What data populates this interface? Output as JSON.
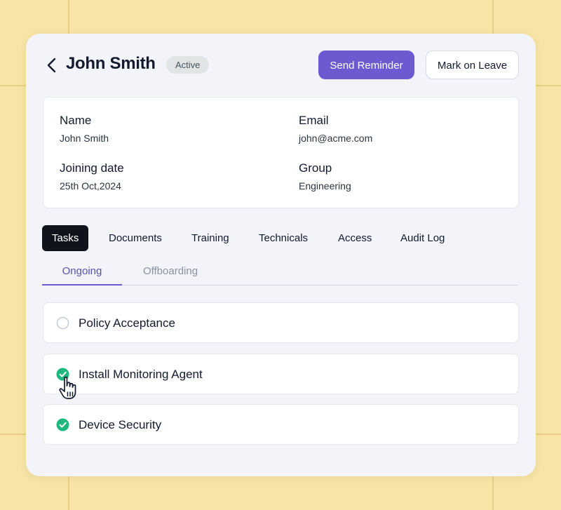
{
  "header": {
    "title": "John Smith",
    "status_badge": "Active",
    "send_reminder_label": "Send Reminder",
    "mark_on_leave_label": "Mark on Leave",
    "back_icon": "chevron-left-icon"
  },
  "profile": {
    "name": {
      "label": "Name",
      "value": "John Smith"
    },
    "email": {
      "label": "Email",
      "value": "john@acme.com"
    },
    "joining_date": {
      "label": "Joining date",
      "value": "25th Oct,2024"
    },
    "group": {
      "label": "Group",
      "value": "Engineering"
    }
  },
  "tabs": [
    {
      "label": "Tasks",
      "active": true
    },
    {
      "label": "Documents",
      "active": false
    },
    {
      "label": "Training",
      "active": false
    },
    {
      "label": "Technicals",
      "active": false
    },
    {
      "label": "Access",
      "active": false
    },
    {
      "label": "Audit Log",
      "active": false
    }
  ],
  "subtabs": [
    {
      "label": "Ongoing",
      "active": true
    },
    {
      "label": "Offboarding",
      "active": false
    }
  ],
  "tasks": [
    {
      "label": "Policy Acceptance",
      "done": false
    },
    {
      "label": "Install Monitoring Agent",
      "done": true
    },
    {
      "label": "Device Security",
      "done": true
    }
  ],
  "colors": {
    "background": "#f7e4a6",
    "card": "#f3f4f9",
    "primary": "#6c5bd0",
    "active_tab": "#10131c",
    "check_done": "#1db87f",
    "badge_bg": "#e1e5e6"
  }
}
